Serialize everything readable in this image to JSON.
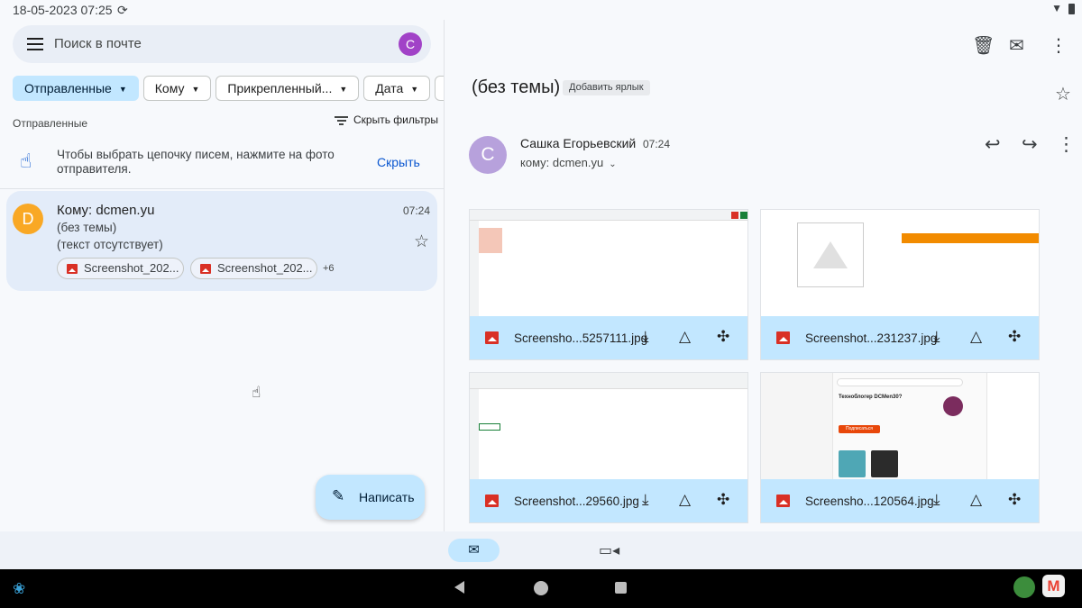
{
  "status_bar": {
    "time": "18-05-2023 07:25"
  },
  "search": {
    "placeholder": "Поиск в почте",
    "avatar_letter": "C"
  },
  "filters": [
    {
      "label": "Отправленные",
      "active": true
    },
    {
      "label": "Кому",
      "active": false
    },
    {
      "label": "Прикрепленный...",
      "active": false
    },
    {
      "label": "Дата",
      "active": false
    }
  ],
  "list": {
    "folder": "Отправленные",
    "hide_filters": "Скрыть фильтры",
    "tip_text": "Чтобы выбрать цепочку писем, нажмите на фото отправителя.",
    "tip_button": "Скрыть"
  },
  "mail_item": {
    "avatar_letter": "D",
    "to": "Кому: dcmen.yu",
    "time": "07:24",
    "subject": "(без темы)",
    "snippet": "(текст отсутствует)",
    "attachments": [
      "Screenshot_202...",
      "Screenshot_202..."
    ],
    "more": "+6"
  },
  "compose": {
    "label": "Написать"
  },
  "message": {
    "subject": "(без темы)",
    "add_label": "Добавить ярлык",
    "sender_avatar": "C",
    "sender": "Сашка Егорьевский",
    "time": "07:24",
    "recipient": "кому: dcmen.yu"
  },
  "attachments": [
    {
      "filename": "Screensho...5257111.jpg"
    },
    {
      "filename": "Screenshot...231237.jpg"
    },
    {
      "filename": "Screenshot...29560.jpg"
    },
    {
      "filename": "Screensho...120564.jpg"
    }
  ],
  "thumb_text": {
    "promo_title": "Техноблогер DCMen30?",
    "promo_button": "Подписаться"
  },
  "colors": {
    "accent": "#c2e7ff",
    "link": "#0b57d0",
    "selected_row": "#e3ecf9",
    "gmail_red": "#ea4335"
  }
}
